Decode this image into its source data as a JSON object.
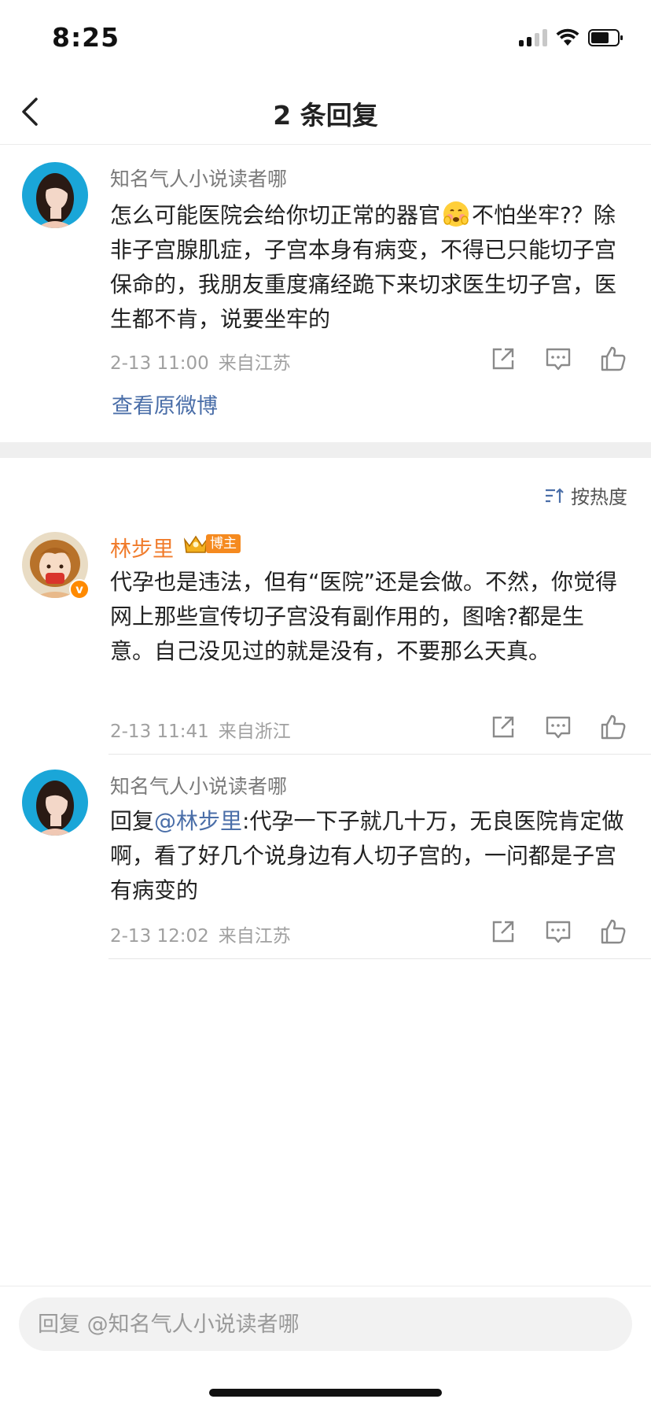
{
  "status_bar": {
    "time": "8:25"
  },
  "nav": {
    "title": "2 条回复",
    "back_icon": "chevron-left-icon"
  },
  "root_comment": {
    "user": "知名气人小说读者哪",
    "text_part1": "怎么可能医院会给你切正常的器官",
    "emoji": "blushing-face-emoji",
    "text_part2": "不怕坐牢?？除非子宫腺肌症，子宫本身有病变，不得已只能切子宫保命的，我朋友重度痛经跪下来切求医生切子宫，医生都不肯，说要坐牢的",
    "date": "2-13 11:00",
    "location": "来自江苏",
    "view_original": "查看原微博"
  },
  "sort_toggle": {
    "label": "按热度",
    "icon": "sort-icon"
  },
  "replies": [
    {
      "user": "林步里",
      "badge": "博主",
      "text": "代孕也是违法，但有“医院”还是会做。不然，你觉得网上那些宣传切子宫没有副作用的，图啥?都是生意。自己没见过的就是没有，不要那么天真。",
      "date": "2-13 11:41",
      "location": "来自浙江",
      "vip_mark": "v"
    },
    {
      "user": "知名气人小说读者哪",
      "reply_prefix": "回复",
      "mention": "@林步里",
      "text": ":代孕一下子就几十万，无良医院肯定做啊，看了好几个说身边有人切子宫的，一问都是子宫有病变的",
      "date": "2-13 12:02",
      "location": "来自江苏"
    }
  ],
  "reply_input": {
    "placeholder": "回复 @知名气人小说读者哪"
  },
  "colors": {
    "link": "#4a6ea8",
    "blogger_name": "#f07b2b",
    "badge": "#f58a1f"
  }
}
